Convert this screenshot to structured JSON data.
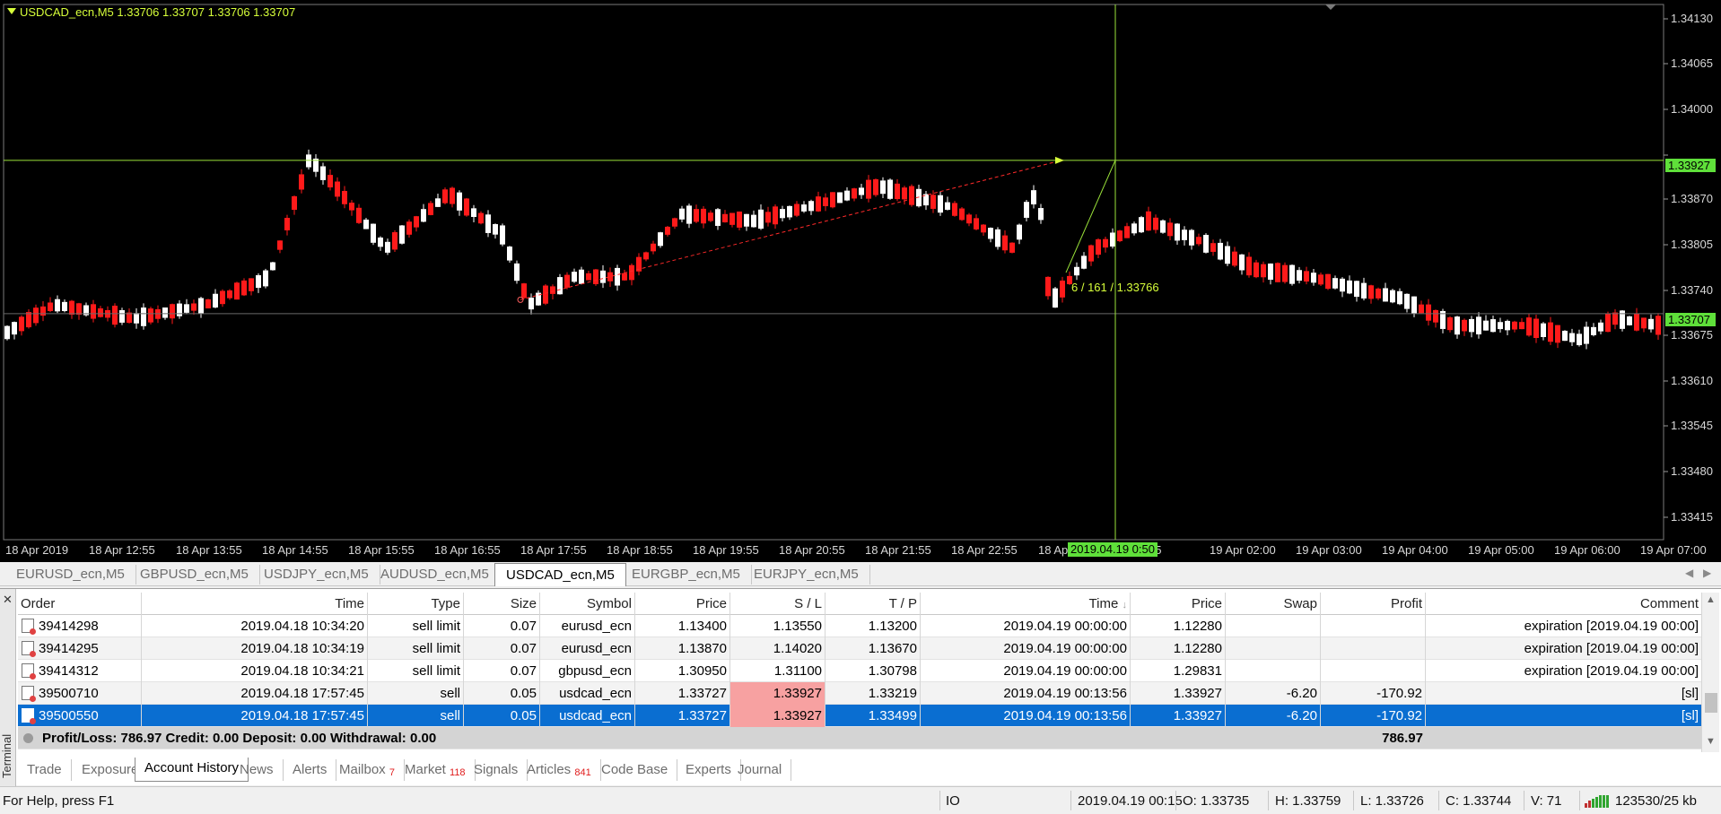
{
  "chart": {
    "title": "USDCAD_ecn,M5  1.33706 1.33707 1.33706 1.33707",
    "price_axis": [
      "1.34130",
      "1.34065",
      "1.34000",
      "1.33870",
      "1.33805",
      "1.33740",
      "1.33675",
      "1.33610",
      "1.33545",
      "1.33480",
      "1.33415"
    ],
    "price_tags": [
      "1.33927",
      "1.33707"
    ],
    "time_axis": [
      "18 Apr 2019",
      "18 Apr 12:55",
      "18 Apr 13:55",
      "18 Apr 14:55",
      "18 Apr 15:55",
      "18 Apr 16:55",
      "18 Apr 17:55",
      "18 Apr 18:55",
      "18 Apr 19:55",
      "18 Apr 20:55",
      "18 Apr 21:55",
      "18 Apr 22:55",
      "18 Ap",
      "00:55",
      "19 Apr 02:00",
      "19 Apr 03:00",
      "19 Apr 04:00",
      "19 Apr 05:00",
      "19 Apr 06:00",
      "19 Apr 07:00"
    ],
    "crosshair_time": "2019.04.19 0:50",
    "crosshair_readout": "6 / 161 / 1.33766",
    "colors": {
      "background": "#000000",
      "bull": "#ffffff",
      "bear": "#ff1a1a",
      "crosshair": "#9be33a",
      "labels": "#d7ff3a"
    }
  },
  "symbol_tabs": [
    {
      "label": "EURUSD_ecn,M5",
      "active": false
    },
    {
      "label": "GBPUSD_ecn,M5",
      "active": false
    },
    {
      "label": "USDJPY_ecn,M5",
      "active": false
    },
    {
      "label": "AUDUSD_ecn,M5",
      "active": false
    },
    {
      "label": "USDCAD_ecn,M5",
      "active": true
    },
    {
      "label": "EURGBP_ecn,M5",
      "active": false
    },
    {
      "label": "EURJPY_ecn,M5",
      "active": false
    }
  ],
  "history": {
    "columns": [
      "Order",
      "Time",
      "Type",
      "Size",
      "Symbol",
      "Price",
      "S / L",
      "T / P",
      "Time",
      "Price",
      "Swap",
      "Profit",
      "Comment"
    ],
    "rows": [
      {
        "order": "39414298",
        "open_time": "2019.04.18 10:34:20",
        "type": "sell limit",
        "size": "0.07",
        "symbol": "eurusd_ecn",
        "price": "1.13400",
        "sl": "1.13550",
        "tp": "1.13200",
        "close_time": "2019.04.19 00:00:00",
        "close_price": "1.12280",
        "swap": "",
        "profit": "",
        "comment": "expiration [2019.04.19 00:00]",
        "sl_hit": false,
        "selected": false
      },
      {
        "order": "39414295",
        "open_time": "2019.04.18 10:34:19",
        "type": "sell limit",
        "size": "0.07",
        "symbol": "eurusd_ecn",
        "price": "1.13870",
        "sl": "1.14020",
        "tp": "1.13670",
        "close_time": "2019.04.19 00:00:00",
        "close_price": "1.12280",
        "swap": "",
        "profit": "",
        "comment": "expiration [2019.04.19 00:00]",
        "sl_hit": false,
        "selected": false
      },
      {
        "order": "39414312",
        "open_time": "2019.04.18 10:34:21",
        "type": "sell limit",
        "size": "0.07",
        "symbol": "gbpusd_ecn",
        "price": "1.30950",
        "sl": "1.31100",
        "tp": "1.30798",
        "close_time": "2019.04.19 00:00:00",
        "close_price": "1.29831",
        "swap": "",
        "profit": "",
        "comment": "expiration [2019.04.19 00:00]",
        "sl_hit": false,
        "selected": false
      },
      {
        "order": "39500710",
        "open_time": "2019.04.18 17:57:45",
        "type": "sell",
        "size": "0.05",
        "symbol": "usdcad_ecn",
        "price": "1.33727",
        "sl": "1.33927",
        "tp": "1.33219",
        "close_time": "2019.04.19 00:13:56",
        "close_price": "1.33927",
        "swap": "-6.20",
        "profit": "-170.92",
        "comment": "[sl]",
        "sl_hit": true,
        "selected": false
      },
      {
        "order": "39500550",
        "open_time": "2019.04.18 17:57:45",
        "type": "sell",
        "size": "0.05",
        "symbol": "usdcad_ecn",
        "price": "1.33727",
        "sl": "1.33927",
        "tp": "1.33499",
        "close_time": "2019.04.19 00:13:56",
        "close_price": "1.33927",
        "swap": "-6.20",
        "profit": "-170.92",
        "comment": "[sl]",
        "sl_hit": true,
        "selected": true
      }
    ],
    "summary": {
      "text": "Profit/Loss: 786.97  Credit: 0.00  Deposit: 0.00  Withdrawal: 0.00",
      "total": "786.97"
    }
  },
  "terminal_label": "Terminal",
  "bottom_tabs": [
    {
      "label": "Trade",
      "badge": "",
      "active": false
    },
    {
      "label": "Exposure",
      "badge": "",
      "active": false
    },
    {
      "label": "Account History",
      "badge": "",
      "active": true
    },
    {
      "label": "News",
      "badge": "",
      "active": false
    },
    {
      "label": "Alerts",
      "badge": "",
      "active": false
    },
    {
      "label": "Mailbox",
      "badge": "7",
      "active": false
    },
    {
      "label": "Market",
      "badge": "118",
      "active": false
    },
    {
      "label": "Signals",
      "badge": "",
      "active": false
    },
    {
      "label": "Articles",
      "badge": "841",
      "active": false
    },
    {
      "label": "Code Base",
      "badge": "",
      "active": false
    },
    {
      "label": "Experts",
      "badge": "",
      "active": false
    },
    {
      "label": "Journal",
      "badge": "",
      "active": false
    }
  ],
  "status_bar": {
    "help": "For Help, press F1",
    "profile": "IO",
    "datetime": "2019.04.19 00:15",
    "open": "O: 1.33735",
    "high": "H: 1.33759",
    "low": "L: 1.33726",
    "close": "C: 1.33744",
    "volume": "V: 71",
    "traffic": "123530/25 kb"
  }
}
